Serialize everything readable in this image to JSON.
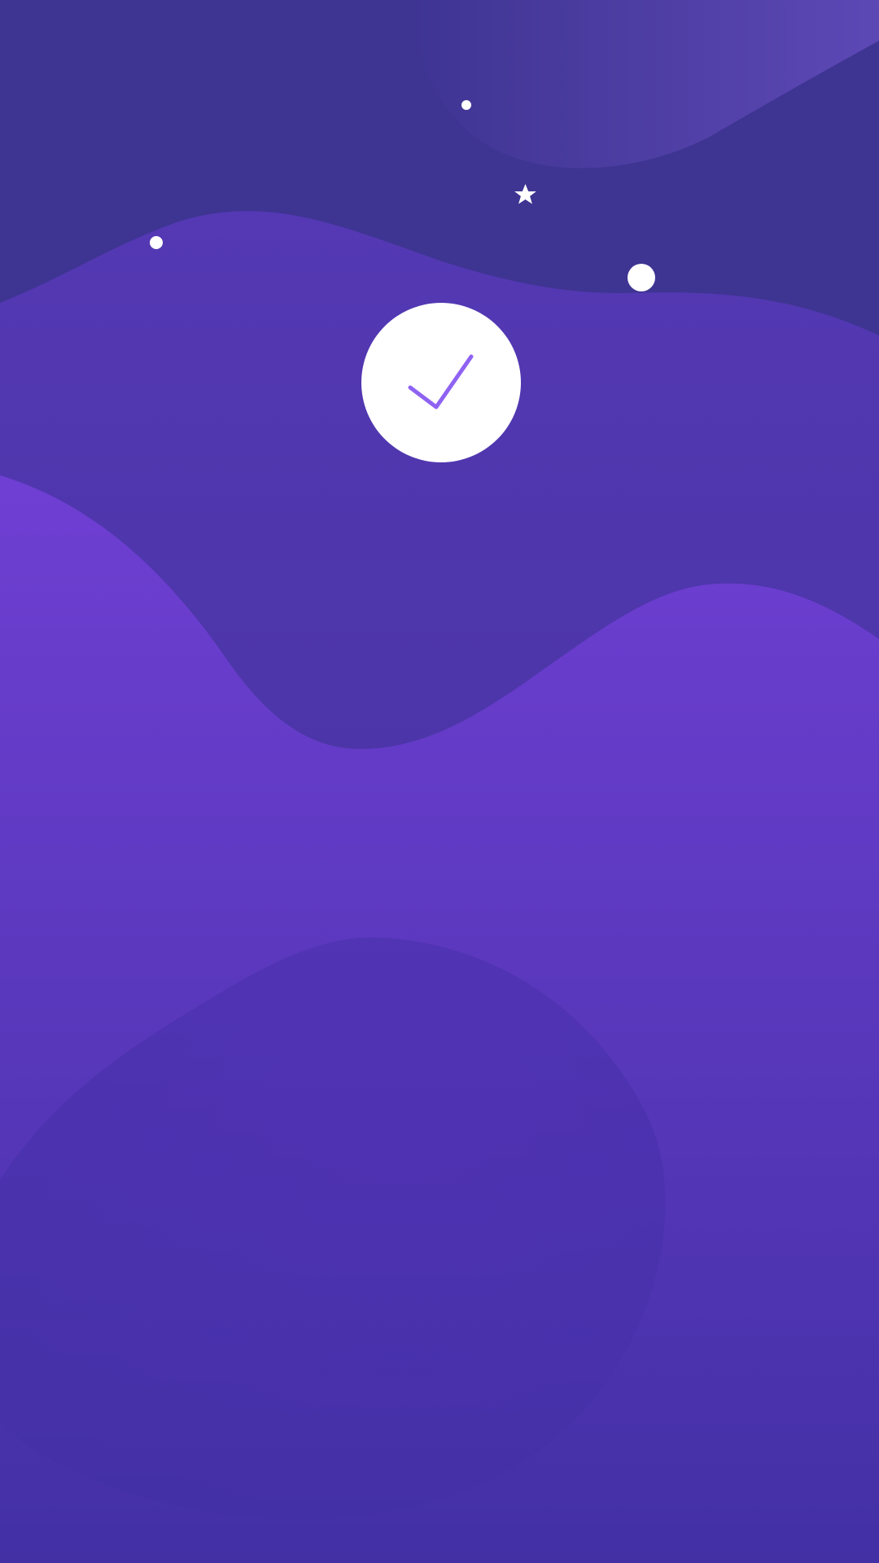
{
  "screen": {
    "type": "success-confirmation",
    "status": "success"
  },
  "colors": {
    "top_background": "#3e3492",
    "top_glow": "#5e49b6",
    "mid_wave_top": "#5438b4",
    "mid_wave_bottom": "#3f3196",
    "bottom_wave_top": "#6f3fd3",
    "bottom_wave_bottom": "#4330a5",
    "bottom_blob": "#4a2fae",
    "sparkle": "#ffffff",
    "badge_fill": "#ffffff",
    "check": "#8f63f2"
  },
  "icons": {
    "badge": "success-check-icon",
    "decorations": [
      "sparkle-dot-icon",
      "sparkle-star-icon",
      "sparkle-dot-icon",
      "sparkle-dot-icon"
    ]
  }
}
